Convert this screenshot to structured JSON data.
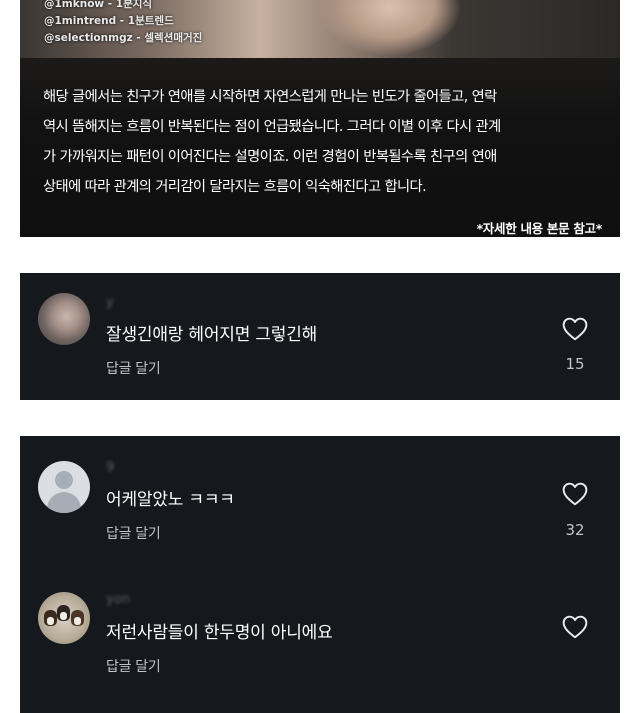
{
  "post": {
    "credits": [
      "@1mknow - 1분지식",
      "@1mintrend - 1분트렌드",
      "@selectionmgz - 셀렉션매거진"
    ],
    "body_lines": [
      "해당 글에서는 친구가 연애를 시작하면 자연스럽게 만나는 빈도가 줄어들고, 연락",
      "역시 뜸해지는 흐름이 반복된다는 점이 언급됐습니다. 그러다 이별 이후 다시 관계",
      "가 가까워지는 패턴이 이어진다는 설명이죠. 이런 경험이 반복될수록 친구의 연애",
      "상태에 따라 관계의 거리감이 달라지는 흐름이 익숙해진다고 합니다."
    ],
    "note": "*자세한 내용 본문 참고*"
  },
  "comments_group1": [
    {
      "username": "y",
      "text": "잘생긴애랑 헤어지면 그렇긴해",
      "reply_label": "답글 달기",
      "likes": "15",
      "avatar_icon": "profile-photo-avatar",
      "heart_icon": "heart-outline-icon"
    }
  ],
  "comments_group2": [
    {
      "username": "9",
      "text": "어케알았노 ㅋㅋㅋ",
      "reply_label": "답글 달기",
      "likes": "32",
      "avatar_icon": "default-user-avatar",
      "heart_icon": "heart-outline-icon"
    },
    {
      "username": "yon",
      "text": "저런사람들이 한두명이 아니에요",
      "reply_label": "답글 달기",
      "likes": "",
      "avatar_icon": "dogs-photo-avatar",
      "heart_icon": "heart-outline-icon"
    }
  ],
  "colors": {
    "comment_bg": "#15181c",
    "text_primary": "#ffffff",
    "text_secondary": "#c0c4c9",
    "page_bg": "#ffffff"
  }
}
